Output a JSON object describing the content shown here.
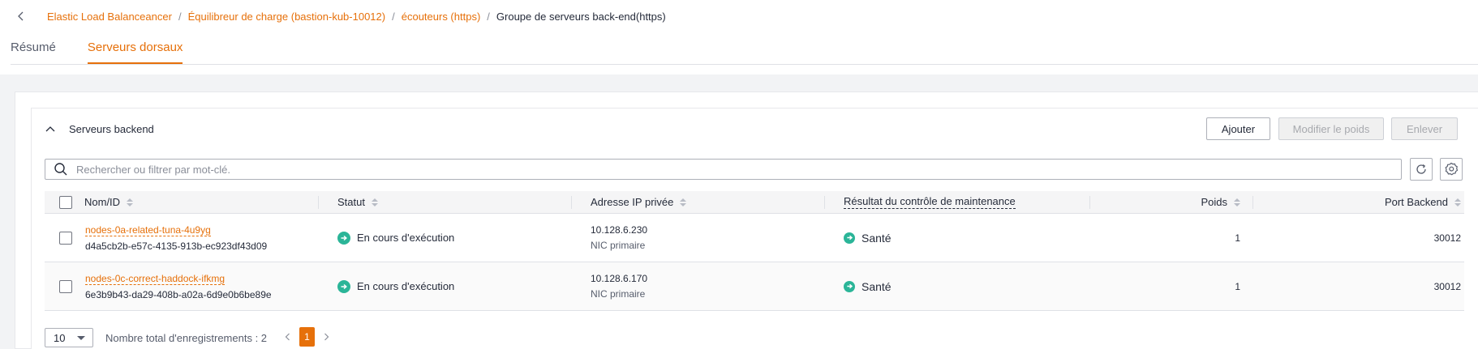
{
  "breadcrumb": {
    "items": [
      "Elastic Load Balanceancer",
      "Équilibreur de charge (bastion-kub-10012)",
      "écouteurs (https)"
    ],
    "current": "Groupe de serveurs back-end(https)"
  },
  "tabs": [
    {
      "label": "Résumé",
      "active": false
    },
    {
      "label": "Serveurs dorsaux",
      "active": true
    }
  ],
  "panel": {
    "title": "Serveurs backend",
    "buttons": {
      "add": "Ajouter",
      "modify_weight": "Modifier le poids",
      "remove": "Enlever"
    }
  },
  "search": {
    "placeholder": "Rechercher ou filtrer par mot-clé."
  },
  "table": {
    "headers": {
      "name": "Nom/ID",
      "status": "Statut",
      "ip": "Adresse IP privée",
      "health": "Résultat du contrôle de maintenance",
      "weight": "Poids",
      "port": "Port Backend"
    },
    "rows": [
      {
        "name": "nodes-0a-related-tuna-4u9yg",
        "id": "d4a5cb2b-e57c-4135-913b-ec923df43d09",
        "status": "En cours d'exécution",
        "ip": "10.128.6.230",
        "nic": "NIC primaire",
        "health": "Santé",
        "weight": "1",
        "port": "30012"
      },
      {
        "name": "nodes-0c-correct-haddock-ifkmg",
        "id": "6e3b9b43-da29-408b-a02a-6d9e0b6be89e",
        "status": "En cours d'exécution",
        "ip": "10.128.6.170",
        "nic": "NIC primaire",
        "health": "Santé",
        "weight": "1",
        "port": "30012"
      }
    ]
  },
  "pagination": {
    "page_size": "10",
    "total": "Nombre total d'enregistrements : 2",
    "current_page": "1"
  },
  "colors": {
    "accent": "#e6700a",
    "success": "#2bb598"
  }
}
